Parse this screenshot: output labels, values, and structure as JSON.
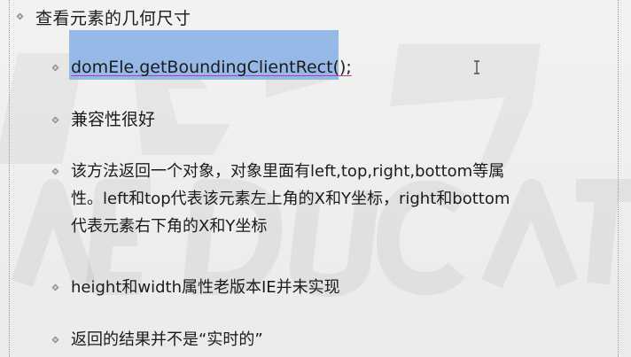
{
  "slide": {
    "title": "查看元素的几何尺寸",
    "items": [
      {
        "text": "domEle.getBoundingClientRect();"
      },
      {
        "text": "兼容性很好"
      },
      {
        "lines": [
          "该方法返回一个对象，对象里面有left,top,right,bottom等属",
          "性。left和top代表该元素左上角的X和Y坐标，right和bottom",
          "代表元素右下角的X和Y坐标"
        ]
      },
      {
        "text": "height和width属性老版本IE并未实现"
      },
      {
        "text": "返回的结果并不是“实时的”"
      }
    ]
  },
  "colors": {
    "bullet": "#8a8a8a",
    "selection": "#87afe6",
    "spell_underline": "#b43ca8"
  },
  "icons": {
    "bullet": "diamond-bullet-icon",
    "cursor": "text-cursor-icon"
  }
}
